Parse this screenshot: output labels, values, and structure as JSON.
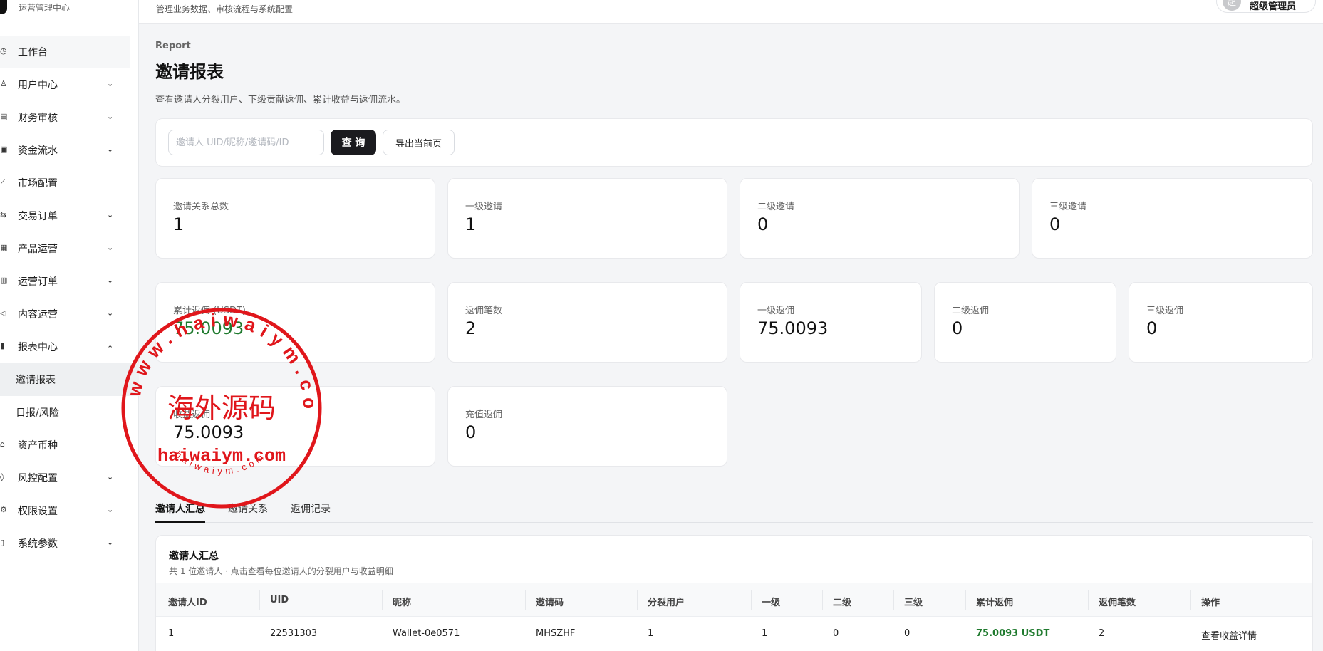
{
  "brand": {
    "subtitle": "运营管理中心"
  },
  "header": {
    "description": "管理业务数据、审核流程与系统配置",
    "avatar_char": "超",
    "user_name": "超级管理员"
  },
  "sidebar": {
    "items": [
      {
        "label": "工作台",
        "icon": "dashboard-icon"
      },
      {
        "label": "用户中心",
        "icon": "users-icon"
      },
      {
        "label": "财务审核",
        "icon": "finance-icon"
      },
      {
        "label": "资金流水",
        "icon": "wallet-icon"
      },
      {
        "label": "市场配置",
        "icon": "chart-line-icon"
      },
      {
        "label": "交易订单",
        "icon": "exchange-icon"
      },
      {
        "label": "产品运营",
        "icon": "product-icon"
      },
      {
        "label": "运营订单",
        "icon": "order-icon"
      },
      {
        "label": "内容运营",
        "icon": "megaphone-icon"
      },
      {
        "label": "报表中心",
        "icon": "bar-chart-icon"
      }
    ],
    "sub_items": [
      {
        "label": "邀请报表"
      },
      {
        "label": "日报/风险"
      }
    ],
    "items_after": [
      {
        "label": "资产币种",
        "icon": "bank-icon"
      },
      {
        "label": "风控配置",
        "icon": "shield-icon"
      },
      {
        "label": "权限设置",
        "icon": "gear-icon"
      },
      {
        "label": "系统参数",
        "icon": "document-icon"
      }
    ]
  },
  "page": {
    "kicker": "Report",
    "title": "邀请报表",
    "description": "查看邀请人分裂用户、下级贡献返佣、累计收益与返佣流水。"
  },
  "search": {
    "placeholder": "邀请人 UID/昵称/邀请码/ID",
    "query_label": "查 询",
    "export_label": "导出当前页"
  },
  "stats_row1": [
    {
      "label": "邀请关系总数",
      "value": "1"
    },
    {
      "label": "一级邀请",
      "value": "1"
    },
    {
      "label": "二级邀请",
      "value": "0"
    },
    {
      "label": "三级邀请",
      "value": "0"
    }
  ],
  "stats_row2": [
    {
      "label": "累计返佣 (USDT)",
      "value": "75.0093"
    },
    {
      "label": "返佣笔数",
      "value": "2"
    },
    {
      "label": "一级返佣",
      "value": "75.0093"
    },
    {
      "label": "二级返佣",
      "value": "0"
    },
    {
      "label": "三级返佣",
      "value": "0"
    }
  ],
  "stats_row3": [
    {
      "label": "收益返佣",
      "value": "75.0093"
    },
    {
      "label": "充值返佣",
      "value": "0"
    }
  ],
  "tabs": [
    {
      "label": "邀请人汇总"
    },
    {
      "label": "邀请关系"
    },
    {
      "label": "返佣记录"
    }
  ],
  "table": {
    "title": "邀请人汇总",
    "subtitle": "共 1 位邀请人 · 点击查看每位邀请人的分裂用户与收益明细",
    "columns": [
      "邀请人ID",
      "UID",
      "昵称",
      "邀请码",
      "分裂用户",
      "一级",
      "二级",
      "三级",
      "累计返佣",
      "返佣笔数",
      "操作"
    ],
    "rows": [
      [
        "1",
        "22531303",
        "Wallet-0e0571",
        "MHSZHF",
        "1",
        "1",
        "0",
        "0",
        "75.0093 USDT",
        "2",
        "查看收益详情"
      ]
    ]
  },
  "watermark": {
    "center_text": "海外源码",
    "domain_text": "haiwaiym.com",
    "ring_text": "www.haiwaiym.com",
    "small_ring_text": "haiwaiym.com",
    "color": "#e0161b"
  },
  "colors": {
    "accent": "#1b1b1f",
    "positive": "#1f7a2e"
  }
}
